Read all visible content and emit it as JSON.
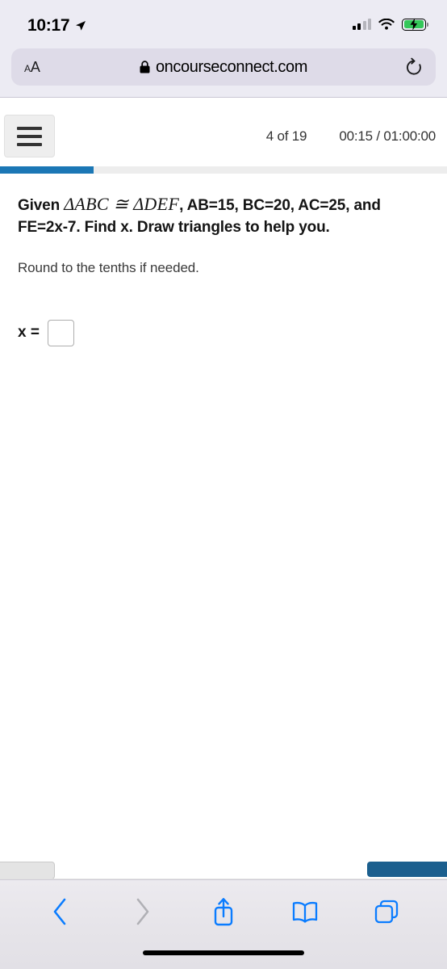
{
  "status_bar": {
    "time": "10:17",
    "location_icon": "location-arrow-icon",
    "signal_icon": "cellular-signal-icon",
    "wifi_icon": "wifi-icon",
    "battery_icon": "battery-charging-icon",
    "battery_color": "#34c759"
  },
  "browser": {
    "text_size_button": "AA",
    "lock_icon": "lock-icon",
    "url": "oncourseconnect.com",
    "reload_icon": "reload-icon",
    "toolbar": {
      "back_label": "Back",
      "forward_label": "Forward",
      "share_label": "Share",
      "bookmarks_label": "Bookmarks",
      "tabs_label": "Tabs",
      "back_color": "#0a7cff",
      "forward_color": "#b0b0b5"
    }
  },
  "app": {
    "menu_icon": "hamburger-menu-icon",
    "page_counter": "4 of 19",
    "timer": "00:15 / 01:00:00",
    "progress_percent": 21,
    "progress_color": "#1b77b5"
  },
  "question": {
    "lead_word": "Given",
    "math_expression": "ΔABC ≅ ΔDEF",
    "statement_rest": ", AB=15, BC=20, AC=25, and FE=2x-7. Find x. Draw triangles to help you.",
    "subtext": "Round to the tenths if needed.",
    "answer_label": "x =",
    "answer_value": "",
    "answer_placeholder": ""
  },
  "nav": {
    "prev_label": "",
    "next_label": "",
    "next_color": "#1b5f8e"
  }
}
